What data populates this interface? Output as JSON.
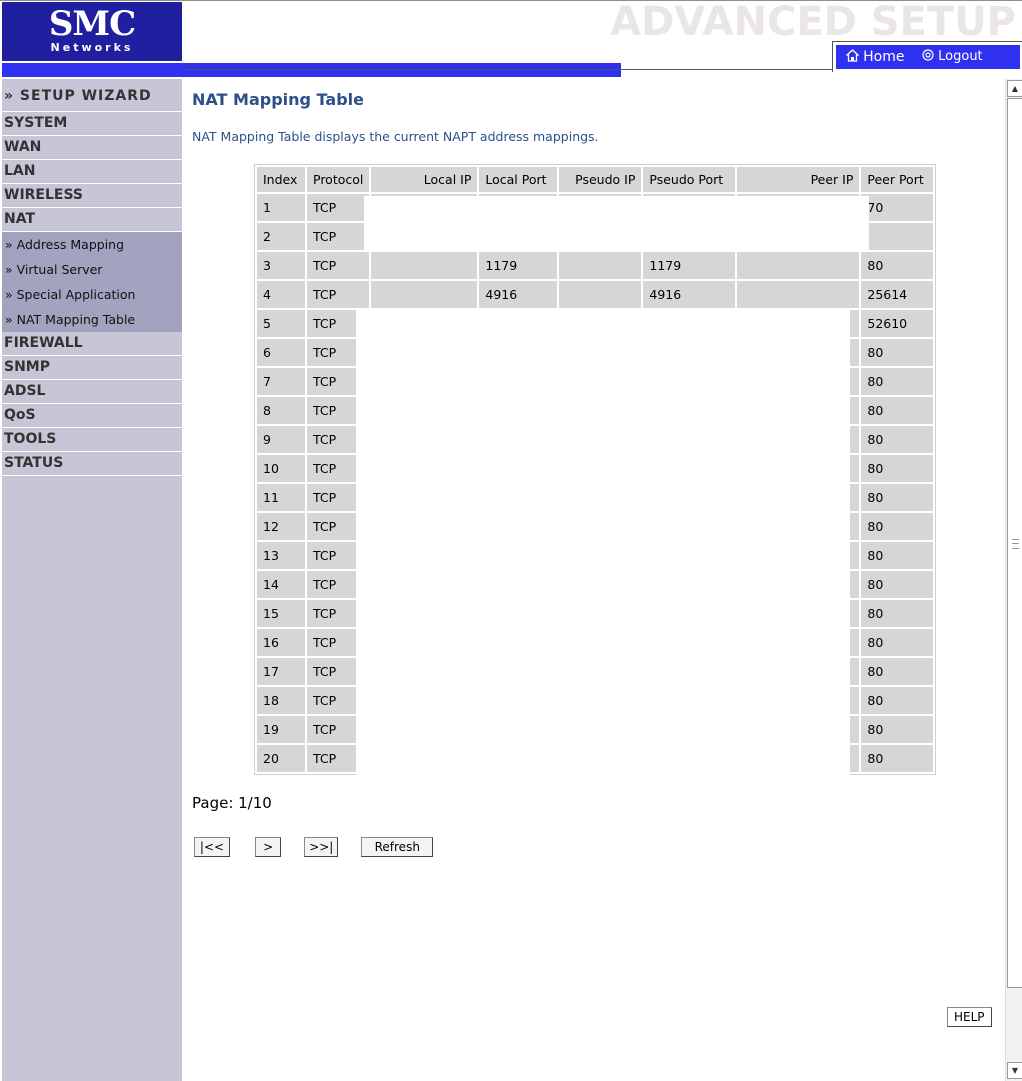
{
  "brand": {
    "logo_main": "SMC",
    "logo_sub": "Networks"
  },
  "header": {
    "title": "ADVANCED SETUP",
    "home_label": "Home",
    "logout_label": "Logout"
  },
  "sidebar": {
    "wizard": "» SETUP WIZARD",
    "items": [
      "SYSTEM",
      "WAN",
      "LAN",
      "WIRELESS",
      "NAT"
    ],
    "nat_sub": [
      "» Address Mapping",
      "» Virtual Server",
      "» Special Application",
      "» NAT Mapping Table"
    ],
    "items_after": [
      "FIREWALL",
      "SNMP",
      "ADSL",
      "QoS",
      "TOOLS",
      "STATUS"
    ]
  },
  "main": {
    "title": "NAT Mapping Table",
    "description": "NAT Mapping Table displays the current NAPT address mappings.",
    "table": {
      "headers": [
        "Index",
        "Protocol",
        "Local IP",
        "Local Port",
        "Pseudo IP",
        "Pseudo Port",
        "Peer IP",
        "Peer Port"
      ],
      "rows": [
        [
          "1",
          "TCP",
          "",
          "",
          "",
          "",
          "",
          "70"
        ],
        [
          "2",
          "TCP",
          "",
          "",
          "",
          "",
          "",
          ""
        ],
        [
          "3",
          "TCP",
          "",
          "1179",
          "",
          "1179",
          "",
          "80"
        ],
        [
          "4",
          "TCP",
          "",
          "4916",
          "",
          "4916",
          "",
          "25614"
        ],
        [
          "5",
          "TCP",
          "",
          "",
          "",
          "",
          "",
          "52610"
        ],
        [
          "6",
          "TCP",
          "",
          "",
          "",
          "",
          "",
          "80"
        ],
        [
          "7",
          "TCP",
          "",
          "",
          "",
          "",
          "",
          "80"
        ],
        [
          "8",
          "TCP",
          "",
          "",
          "",
          "",
          "",
          "80"
        ],
        [
          "9",
          "TCP",
          "",
          "",
          "",
          "",
          "",
          "80"
        ],
        [
          "10",
          "TCP",
          "",
          "",
          "",
          "",
          "",
          "80"
        ],
        [
          "11",
          "TCP",
          "",
          "",
          "",
          "",
          "",
          "80"
        ],
        [
          "12",
          "TCP",
          "",
          "",
          "",
          "",
          "",
          "80"
        ],
        [
          "13",
          "TCP",
          "",
          "",
          "",
          "",
          "",
          "80"
        ],
        [
          "14",
          "TCP",
          "",
          "",
          "",
          "",
          "",
          "80"
        ],
        [
          "15",
          "TCP",
          "",
          "",
          "",
          "",
          "",
          "80"
        ],
        [
          "16",
          "TCP",
          "",
          "",
          "",
          "",
          "",
          "80"
        ],
        [
          "17",
          "TCP",
          "",
          "",
          "",
          "",
          "",
          "80"
        ],
        [
          "18",
          "TCP",
          "",
          "",
          "",
          "",
          "",
          "80"
        ],
        [
          "19",
          "TCP",
          "",
          "",
          "",
          "",
          "",
          "80"
        ],
        [
          "20",
          "TCP",
          "",
          "",
          "",
          "",
          "",
          "80"
        ]
      ]
    },
    "page_info": "Page: 1/10",
    "buttons": {
      "first": "|<<",
      "next": ">",
      "last": ">>|",
      "refresh": "Refresh"
    },
    "help": "HELP"
  },
  "icons": {
    "home": "home-icon",
    "logout": "power-icon"
  },
  "colors": {
    "brand_blue": "#1f1fa0",
    "bar_blue": "#3030f0",
    "sidebar": "#c6c6d7",
    "submenu": "#a3a3bf",
    "title": "#2e4f8a"
  }
}
